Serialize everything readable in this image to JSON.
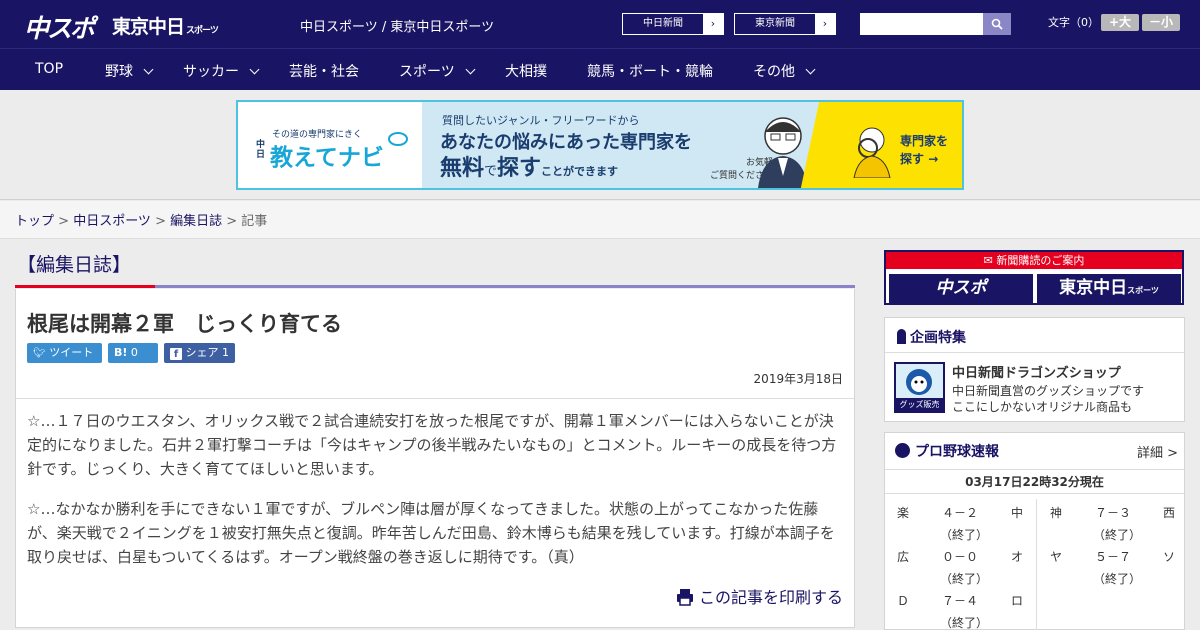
{
  "header": {
    "logo_chuspo": "中スポ",
    "logo_tokyo": "東京中日",
    "logo_tokyo_sub": "スポーツ",
    "site_title": "中日スポーツ / 東京中日スポーツ",
    "btn_chunichi": "中日新聞",
    "btn_tokyo": "東京新聞",
    "search_placeholder": "",
    "font_label": "文字（0）",
    "font_plus": "+大",
    "font_minus": "－小"
  },
  "nav": [
    {
      "label": "TOP"
    },
    {
      "label": "野球"
    },
    {
      "label": "サッカー"
    },
    {
      "label": "芸能・社会"
    },
    {
      "label": "スポーツ"
    },
    {
      "label": "大相撲"
    },
    {
      "label": "競馬・ボート・競輪"
    },
    {
      "label": "その他"
    }
  ],
  "banner": {
    "sub": "その道の専門家にきく",
    "brand": "教えてナビ",
    "brand_prefix": "中日",
    "line1": "質問したいジャンル・フリーワードから",
    "line2": "あなたの悩みにあった専門家を",
    "line3a": "無料",
    "line3b": "で",
    "line3c": "探す",
    "line3d": "ことができます",
    "note1": "お気軽に",
    "note2": "ご質問ください！",
    "cta1": "専門家を",
    "cta2": "探す"
  },
  "breadcrumb": {
    "home": "トップ",
    "sep": " > ",
    "l1": "中日スポーツ",
    "l2": "編集日誌",
    "current": "記事"
  },
  "article": {
    "category": "【編集日誌】",
    "title": "根尾は開幕２軍　じっくり育てる",
    "tweet": "ツイート",
    "hatena": "B!",
    "hatena_count": "0",
    "share": "シェア",
    "share_count": "1",
    "date": "2019年3月18日",
    "para1": "☆…１７日のウエスタン、オリックス戦で２試合連続安打を放った根尾ですが、開幕１軍メンバーには入らないことが決定的になりました。石井２軍打撃コーチは「今はキャンプの後半戦みたいなもの」とコメント。ルーキーの成長を待つ方針です。じっくり、大きく育ててほしいと思います。",
    "para2": "☆…なかなか勝利を手にできない１軍ですが、ブルペン陣は層が厚くなってきました。状態の上がってこなかった佐藤が、楽天戦で２イニングを１被安打無失点と復調。昨年苦しんだ田島、鈴木博らも結果を残しています。打線が本調子を取り戻せば、白星もついてくるはず。オープン戦終盤の巻き返しに期待です。（真）",
    "print": "この記事を印刷する"
  },
  "sidebar": {
    "subscribe_head": "新聞購読のご案内",
    "sub_chuspo": "中スポ",
    "sub_tokyo": "東京中日",
    "sub_tokyo_small": "スポーツ",
    "special_title": "企画特集",
    "shop_title": "中日新聞ドラゴンズショップ",
    "shop_desc1": "中日新聞直営のグッズショップです",
    "shop_desc2": "ここにしかないオリジナル商品も",
    "shop_img_label": "グッズ販売中",
    "baseball_title": "プロ野球速報",
    "baseball_more": "詳細 >",
    "baseball_time": "03月17日22時32分現在",
    "games": [
      {
        "home": "楽",
        "score": "４－２",
        "status": "（終了）",
        "away": "中"
      },
      {
        "home": "神",
        "score": "７－３",
        "status": "（終了）",
        "away": "西"
      },
      {
        "home": "広",
        "score": "０－０",
        "status": "（終了）",
        "away": "オ"
      },
      {
        "home": "ヤ",
        "score": "５－７",
        "status": "（終了）",
        "away": "ソ"
      },
      {
        "home": "Ｄ",
        "score": "７－４",
        "status": "（終了）",
        "away": "ロ"
      }
    ]
  },
  "colors": {
    "navy": "#1a1464",
    "red": "#e5001f",
    "cyan": "#4cc3e0",
    "yellow": "#fde100",
    "twitter": "#3b8fd1",
    "facebook": "#3f5fa3"
  }
}
